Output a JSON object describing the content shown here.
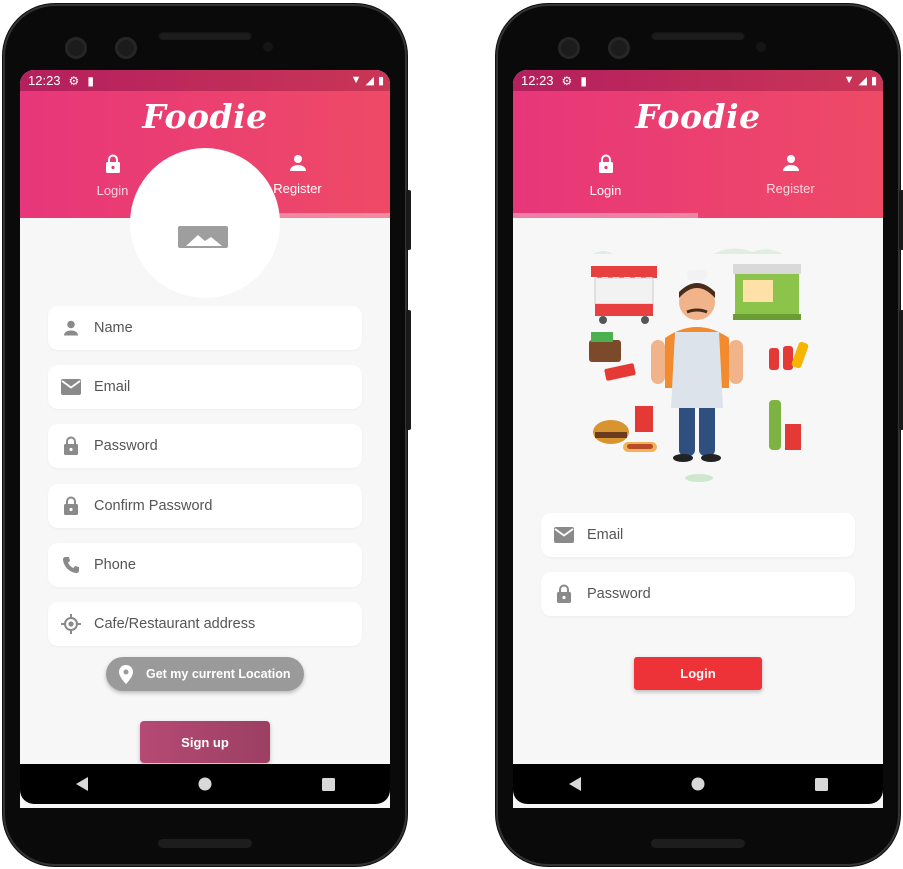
{
  "left_phone": {
    "status": {
      "time": "12:23"
    },
    "app_title": "Foodie",
    "tabs": [
      {
        "label": "Login"
      },
      {
        "label": "Register"
      }
    ],
    "active_tab": "Register",
    "fields": [
      {
        "placeholder": "Name",
        "icon": "person-icon"
      },
      {
        "placeholder": "Email",
        "icon": "email-icon"
      },
      {
        "placeholder": "Password",
        "icon": "lock-icon"
      },
      {
        "placeholder": "Confirm Password",
        "icon": "lock-icon"
      },
      {
        "placeholder": "Phone",
        "icon": "phone-icon"
      },
      {
        "placeholder": "Cafe/Restaurant address",
        "icon": "location-target-icon"
      }
    ],
    "location_button": "Get my current Location",
    "signup_button": "Sign up"
  },
  "right_phone": {
    "status": {
      "time": "12:23"
    },
    "app_title": "Foodie",
    "tabs": [
      {
        "label": "Login"
      },
      {
        "label": "Register"
      }
    ],
    "active_tab": "Login",
    "fields": [
      {
        "placeholder": "Email",
        "icon": "email-icon"
      },
      {
        "placeholder": "Password",
        "icon": "lock-icon"
      }
    ],
    "login_button": "Login"
  },
  "colors": {
    "header_start": "#e8367a",
    "header_end": "#ee4a66",
    "login_button": "#ee3338",
    "signup_button": "#a8446b",
    "location_button": "#9a9a9a"
  }
}
